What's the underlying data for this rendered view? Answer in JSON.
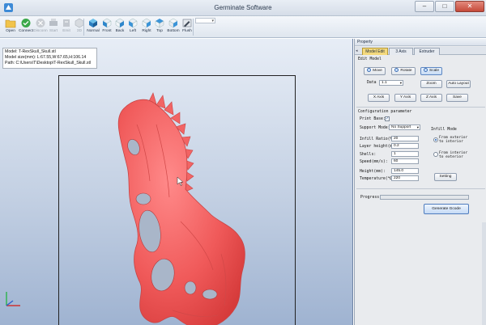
{
  "window": {
    "title": "Germinate Software",
    "min": "–",
    "max": "□",
    "close": "✕"
  },
  "toolbar": {
    "tools": [
      {
        "label": "Open",
        "enabled": true
      },
      {
        "label": "Connect",
        "enabled": true
      },
      {
        "label": "Disconn",
        "enabled": false
      },
      {
        "label": "Start",
        "enabled": false
      },
      {
        "label": "Emit",
        "enabled": false
      },
      {
        "label": "3D",
        "enabled": false
      },
      {
        "label": "Normal",
        "enabled": true
      },
      {
        "label": "Front",
        "enabled": true
      },
      {
        "label": "Back",
        "enabled": true
      },
      {
        "label": "Left",
        "enabled": true
      },
      {
        "label": "Right",
        "enabled": true
      },
      {
        "label": "Top",
        "enabled": true
      },
      {
        "label": "Bottom",
        "enabled": true
      },
      {
        "label": "Flush",
        "enabled": true
      }
    ]
  },
  "model_info": {
    "line1": "Model: T-RexSkull_Skull.stl",
    "line2": "Model size(mm): L:67.55,W:67.65,H:106.14",
    "line3": "Path: C:\\Users\\T\\Desktop\\T-RexSkull_Skull.stl"
  },
  "panel": {
    "header": "Property",
    "tab_nav": "◂",
    "tabs": [
      "Model Edit",
      "3 Axis",
      "Extruder"
    ],
    "active_tab": "Model Edit",
    "edit_model": "Edit Model",
    "buttons": {
      "move": "Move",
      "rotate": "Rotate",
      "scale": "Scale",
      "zoom": "Zoom",
      "auto_layout": "Auto Layout",
      "x_axis": "X Axis",
      "y_axis": "Y Axis",
      "z_axis": "Z Axis",
      "save": "Save",
      "setting": "Setting"
    },
    "data_label": "Data",
    "data_value": "1.1",
    "config": {
      "title": "Configuration parameter",
      "print_base_label": "Print Base:",
      "print_base_checked": true,
      "support_mode_label": "Support Mode:",
      "support_mode_value": "No Support",
      "infill_ratio_label": "Infill Ratio(%):",
      "infill_ratio_value": "20",
      "layer_height_label": "Layer height(mm):",
      "layer_height_value": "0.2",
      "shells_label": "Shells:",
      "shells_value": "1",
      "speed_label": "Speed(mm/s):",
      "speed_value": "60",
      "height_label": "Height(mm):",
      "height_value": "145.0",
      "temperature_label": "Temperature(℃):",
      "temperature_value": "220",
      "infill_mode_title": "Infill Mode",
      "infill_opt1": "From exterior to interior",
      "infill_opt2": "From interior to exterior",
      "infill_selected": 0
    },
    "progress_label": "Progress:",
    "progress": 0,
    "generate_label": "Generate Gcode"
  },
  "colors": {
    "model": "#f05a5a",
    "active_tab": "#f4d97d",
    "viewport_top": "#e7edf6",
    "viewport_bottom": "#9fb3d1"
  }
}
